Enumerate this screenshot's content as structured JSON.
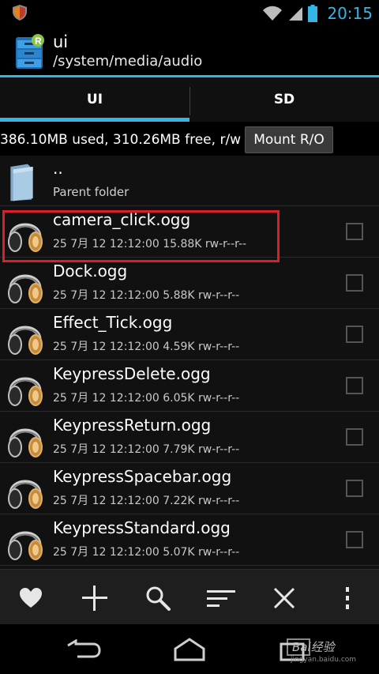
{
  "status_bar": {
    "time": "20:15",
    "colors": {
      "time": "#33b5e5",
      "battery": "#33b5e5"
    }
  },
  "header": {
    "title": "ui",
    "path": "/system/media/audio",
    "accent_color": "#33b5e5"
  },
  "tabs": [
    {
      "label": "UI",
      "selected": true
    },
    {
      "label": "SD",
      "selected": false
    }
  ],
  "storage": {
    "info": "386.10MB used, 310.26MB free, r/w",
    "mount_button_label": "Mount R/O"
  },
  "parent_folder": {
    "name": "..",
    "label": "Parent folder"
  },
  "files": [
    {
      "name": "camera_click.ogg",
      "meta": "25 7月 12 12:12:00  15.88K  rw-r--r--",
      "highlighted": true
    },
    {
      "name": "Dock.ogg",
      "meta": "25 7月 12 12:12:00  5.88K  rw-r--r--"
    },
    {
      "name": "Effect_Tick.ogg",
      "meta": "25 7月 12 12:12:00  4.59K  rw-r--r--"
    },
    {
      "name": "KeypressDelete.ogg",
      "meta": "25 7月 12 12:12:00  6.05K  rw-r--r--"
    },
    {
      "name": "KeypressReturn.ogg",
      "meta": "25 7月 12 12:12:00  7.79K  rw-r--r--"
    },
    {
      "name": "KeypressSpacebar.ogg",
      "meta": "25 7月 12 12:12:00  7.22K  rw-r--r--"
    },
    {
      "name": "KeypressStandard.ogg",
      "meta": "25 7月 12 12:12:00  5.07K  rw-r--r--"
    }
  ],
  "toolbar_icons": [
    "heart-icon",
    "plus-icon",
    "search-icon",
    "sort-icon",
    "close-icon",
    "more-icon"
  ],
  "watermark": {
    "text": "Bai经验",
    "sub": "jingyan.baidu.com"
  },
  "highlight_color": "#d9202a"
}
